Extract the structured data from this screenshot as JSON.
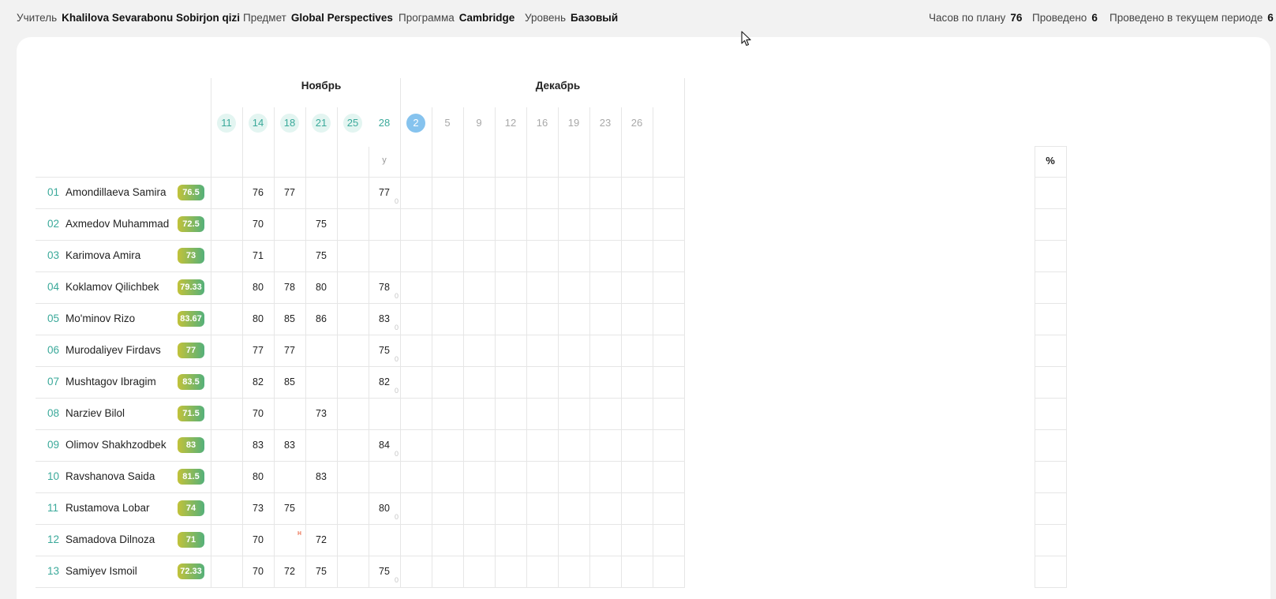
{
  "header": {
    "teacher_label": "Учитель",
    "teacher_value": "Khalilova Sevarabonu Sobirjon qizi",
    "subject_label": "Предмет",
    "subject_value": "Global Perspectives",
    "program_label": "Программа",
    "program_value": "Cambridge",
    "level_label": "Уровень",
    "level_value": "Базовый",
    "hours_label": "Часов по плану",
    "hours_value": "76",
    "held_label": "Проведено",
    "held_value": "6",
    "held_period_label": "Проведено в текущем периоде",
    "held_period_value": "6"
  },
  "months": [
    {
      "label": "Ноябрь"
    },
    {
      "label": "Декабрь"
    }
  ],
  "dates": [
    {
      "label": "11",
      "state": "done"
    },
    {
      "label": "14",
      "state": "done"
    },
    {
      "label": "18",
      "state": "done"
    },
    {
      "label": "21",
      "state": "done"
    },
    {
      "label": "25",
      "state": "done"
    },
    {
      "label": "28",
      "state": "plain-green"
    },
    {
      "label": "2",
      "state": "current"
    },
    {
      "label": "5",
      "state": "future"
    },
    {
      "label": "9",
      "state": "future"
    },
    {
      "label": "12",
      "state": "future"
    },
    {
      "label": "16",
      "state": "future"
    },
    {
      "label": "19",
      "state": "future"
    },
    {
      "label": "23",
      "state": "future"
    },
    {
      "label": "26",
      "state": "future"
    }
  ],
  "subheader_y": "у",
  "percent_header": "%",
  "students": [
    {
      "num": "01",
      "name": "Amondillaeva Samira",
      "avg": "76.5",
      "g14": "76",
      "g18": "77",
      "g21": "",
      "g25": "77",
      "z": "0",
      "n": ""
    },
    {
      "num": "02",
      "name": "Axmedov Muhammad",
      "avg": "72.5",
      "g14": "70",
      "g18": "",
      "g21": "75",
      "g25": "",
      "z": "",
      "n": ""
    },
    {
      "num": "03",
      "name": "Karimova Amira",
      "avg": "73",
      "g14": "71",
      "g18": "",
      "g21": "75",
      "g25": "",
      "z": "",
      "n": ""
    },
    {
      "num": "04",
      "name": "Koklamov Qilichbek",
      "avg": "79.33",
      "g14": "80",
      "g18": "78",
      "g21": "80",
      "g25": "78",
      "z": "0",
      "n": ""
    },
    {
      "num": "05",
      "name": "Mo'minov Rizo",
      "avg": "83.67",
      "g14": "80",
      "g18": "85",
      "g21": "86",
      "g25": "83",
      "z": "0",
      "n": ""
    },
    {
      "num": "06",
      "name": "Murodaliyev Firdavs",
      "avg": "77",
      "g14": "77",
      "g18": "77",
      "g21": "",
      "g25": "75",
      "z": "0",
      "n": ""
    },
    {
      "num": "07",
      "name": "Mushtagov Ibragim",
      "avg": "83.5",
      "g14": "82",
      "g18": "85",
      "g21": "",
      "g25": "82",
      "z": "0",
      "n": ""
    },
    {
      "num": "08",
      "name": "Narziev Bilol",
      "avg": "71.5",
      "g14": "70",
      "g18": "",
      "g21": "73",
      "g25": "",
      "z": "",
      "n": ""
    },
    {
      "num": "09",
      "name": "Olimov Shakhzodbek",
      "avg": "83",
      "g14": "83",
      "g18": "83",
      "g21": "",
      "g25": "84",
      "z": "0",
      "n": ""
    },
    {
      "num": "10",
      "name": "Ravshanova Saida",
      "avg": "81.5",
      "g14": "80",
      "g18": "",
      "g21": "83",
      "g25": "",
      "z": "",
      "n": ""
    },
    {
      "num": "11",
      "name": "Rustamova Lobar",
      "avg": "74",
      "g14": "73",
      "g18": "75",
      "g21": "",
      "g25": "80",
      "z": "0",
      "n": ""
    },
    {
      "num": "12",
      "name": "Samadova Dilnoza",
      "avg": "71",
      "g14": "70",
      "g18": "",
      "g21": "72",
      "g25": "",
      "z": "",
      "n": "н"
    },
    {
      "num": "13",
      "name": "Samiyev Ismoil",
      "avg": "72.33",
      "g14": "70",
      "g18": "72",
      "g21": "75",
      "g25": "75",
      "z": "0",
      "n": ""
    }
  ]
}
